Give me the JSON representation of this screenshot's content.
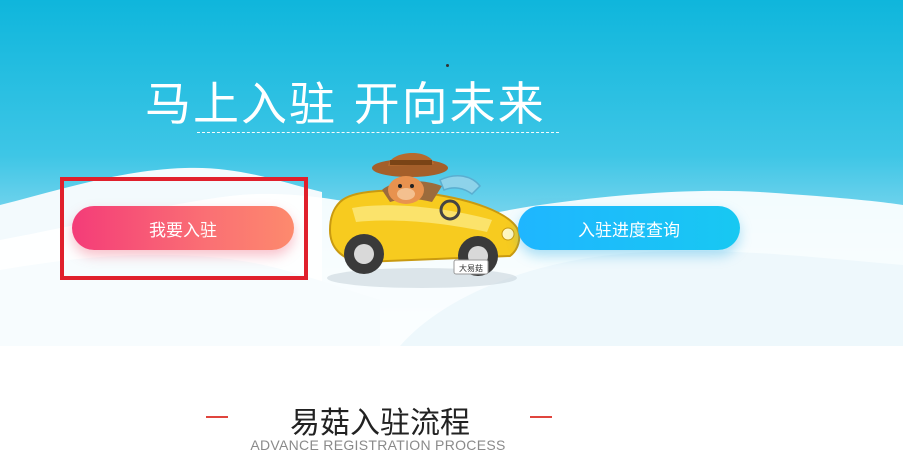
{
  "hero": {
    "title": "马上入驻 开向未来",
    "join_button": "我要入驻",
    "query_button": "入驻进度查询",
    "car_plate": "大易菇"
  },
  "section": {
    "title": "易菇入驻流程",
    "subtitle": "ADVANCE REGISTRATION PROCESS"
  },
  "colors": {
    "hero_top": "#0fb6dc",
    "join_button": "#f43c78",
    "query_button": "#1fb6ff",
    "highlight": "#e0202c",
    "accent_dash": "#e0453d"
  }
}
